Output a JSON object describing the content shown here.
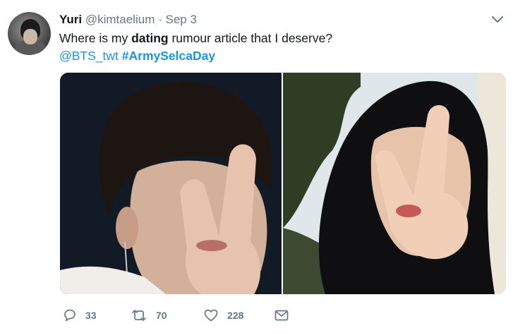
{
  "user": {
    "name": "Yuri",
    "handle": "@kimtaelium",
    "separator": "·",
    "date": "Sep 3"
  },
  "tweet": {
    "text_before": "Where is my ",
    "text_bold": "dating",
    "text_after": " rumour article that I deserve?",
    "mention": "@BTS_twt",
    "hashtag": "#ArmySelcaDay"
  },
  "media": {
    "photos": [
      {
        "description": "selfie-peace-sign-1"
      },
      {
        "description": "selfie-peace-sign-2"
      }
    ]
  },
  "actions": {
    "reply_count": "33",
    "retweet_count": "70",
    "like_count": "228"
  },
  "icons": {
    "reply": "reply-icon",
    "retweet": "retweet-icon",
    "like": "heart-icon",
    "message": "envelope-icon",
    "menu": "chevron-down-icon"
  },
  "colors": {
    "link": "#1b95e0",
    "secondary_text": "#657786",
    "primary_text": "#14171a"
  }
}
